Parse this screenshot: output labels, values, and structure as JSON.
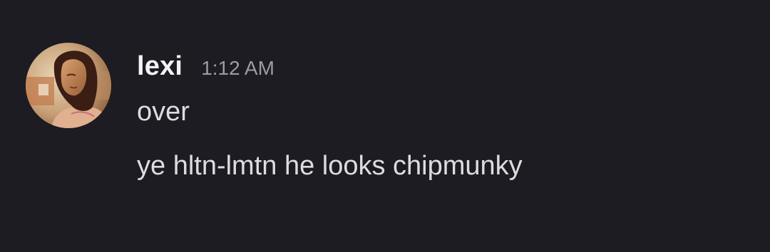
{
  "message": {
    "author": "lexi",
    "timestamp": "1:12 AM",
    "avatar_icon": "user-avatar-photo",
    "lines": [
      "over",
      "ye hltn-lmtn he looks chipmunky"
    ]
  },
  "colors": {
    "background": "#1c1c22",
    "username": "#f2f3f5",
    "timestamp": "#9b9ca4",
    "message_text": "#dcdde1"
  }
}
